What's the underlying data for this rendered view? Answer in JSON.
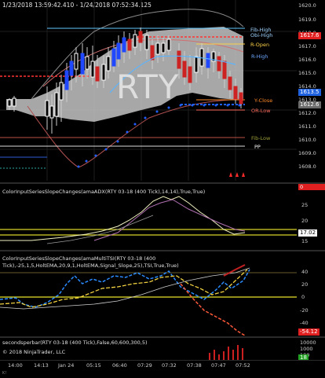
{
  "header": {
    "range_text": "1/23/2018 13:59:42.410 - 1/24/2018 07:52:34.125"
  },
  "main_panel": {
    "watermark": "RTY",
    "price_axis": [
      "1620.0",
      "1619.0",
      "1618.0",
      "1617.0",
      "1616.0",
      "1615.0",
      "1614.0",
      "1613.0",
      "1612.0",
      "1611.0",
      "1610.0",
      "1609.0",
      "1608.0"
    ],
    "price_tags": {
      "last_red": "1617.6",
      "current_blue": "1613.5",
      "close_gray": "1612.6"
    },
    "levels": {
      "fib_high": "Fib-High",
      "obi_high": "Obi-High",
      "r_open": "R-Open",
      "r_high": "R-High",
      "y_close": "Y-Close",
      "or_low": "OR-Low",
      "fib_low": "Fib-Low",
      "pp": "PP"
    },
    "colors": {
      "fib": "#9fd3ff",
      "r_open": "#ffd24a",
      "y_close": "#ff8a2a",
      "or_low": "#ff6b5b",
      "pp": "#ffffff"
    }
  },
  "adx_panel": {
    "title": "ColorInputSeriesSlopeChanges(amaADX(RTY 03-18 (400 Tick),14,14),True,True)",
    "axis": [
      "25",
      "20",
      "15"
    ],
    "value_tag": "17.02"
  },
  "tsi_panel": {
    "title_line1": "ColorInputSeriesSlopeChanges(amaMultiTSI(RTY 03-18 (400",
    "title_line2": "Tick),-25,1,5,HoltEMA,20,9,1,HoltEMA,Signal_Slope,25),TSI,True,True)",
    "axis": [
      "40",
      "20",
      "0",
      "-20",
      "-40"
    ],
    "value_tag": "-54.12"
  },
  "volume_panel": {
    "title": "secondsperbar(RTY 03-18 (400 Tick),False,60,600,300,5)",
    "copyright": "© 2018 NinjaTrader, LLC",
    "axis": [
      "10000",
      "1000",
      "100",
      "10"
    ],
    "value_tag": "18"
  },
  "time_axis": [
    "14:00",
    "14:13",
    "Jan 24",
    "05:15",
    "06:40",
    "07:29",
    "07:32",
    "07:38",
    "07:47",
    "07:52"
  ],
  "top_right_badge": "0",
  "corner_label": "K!"
}
